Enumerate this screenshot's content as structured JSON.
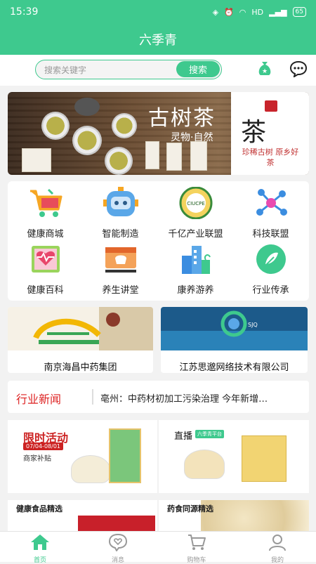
{
  "status": {
    "time": "15:39",
    "network": "HD",
    "battery": "65"
  },
  "header": {
    "title": "六季青"
  },
  "search": {
    "placeholder": "搜索关键字",
    "button": "搜索"
  },
  "banner": {
    "title": "古树茶",
    "subtitle": "灵物·自然",
    "side_char": "茶",
    "side_text": "珍稀古树 原乡好茶"
  },
  "grid": [
    {
      "label": "健康商城",
      "icon": "shopping-cart-icon"
    },
    {
      "label": "智能制造",
      "icon": "robot-icon"
    },
    {
      "label": "千亿产业联盟",
      "icon": "alliance-badge-icon",
      "badge": "CIUCPE"
    },
    {
      "label": "科技联盟",
      "icon": "molecule-icon"
    },
    {
      "label": "健康百科",
      "icon": "book-heart-icon"
    },
    {
      "label": "养生讲堂",
      "icon": "video-board-icon"
    },
    {
      "label": "康养游养",
      "icon": "building-icon"
    },
    {
      "label": "行业传承",
      "icon": "leaf-logo-icon"
    }
  ],
  "cards": [
    {
      "label": "南京海昌中药集团"
    },
    {
      "label": "江苏思邈网络技术有限公司"
    }
  ],
  "news": {
    "tag": "行业新闻",
    "headline": "亳州：中药材初加工污染治理 今年新增…"
  },
  "promo": {
    "title": "限时活动",
    "date": "07/04-08/01",
    "subsidy": "商家补贴",
    "live": "直播",
    "live_tag": "六季青平台"
  },
  "features": [
    {
      "label": "健康食品精选"
    },
    {
      "label": "药食同源精选"
    }
  ],
  "tabs": [
    {
      "label": "首页",
      "icon": "home-icon",
      "active": true
    },
    {
      "label": "消息",
      "icon": "message-heart-icon"
    },
    {
      "label": "购物车",
      "icon": "cart-icon"
    },
    {
      "label": "我的",
      "icon": "user-icon"
    }
  ],
  "colors": {
    "brand": "#3ec98e",
    "news_tag": "#dd2222",
    "promo_title": "#cc2222"
  }
}
